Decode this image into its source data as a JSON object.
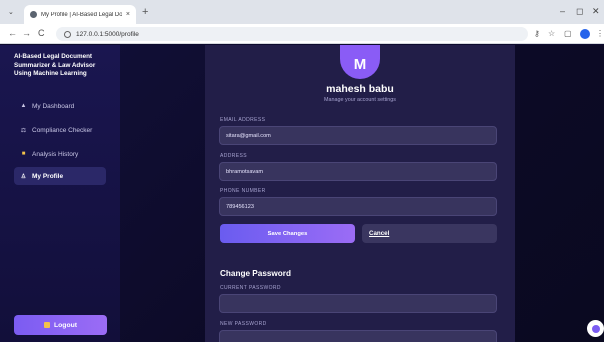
{
  "browser": {
    "tab_title": "My Profile | AI-Based Legal Docum",
    "tab_close": "×",
    "tab_menu": "⌄",
    "new_tab": "+",
    "url": "127.0.0.1:5000/profile",
    "window_controls": {
      "minimize": "–",
      "maximize": "◻",
      "close": "✕"
    },
    "nav": {
      "back": "←",
      "forward": "→",
      "reload": "C"
    },
    "tools": {
      "password": "⚷",
      "star": "☆",
      "extensions": "▢",
      "menu": "⋮"
    }
  },
  "sidebar": {
    "brand": "AI-Based Legal Document Summarizer & Law Advisor Using Machine Learning",
    "items": [
      {
        "label": "My Dashboard",
        "icon": "home-icon",
        "glyph": "▲"
      },
      {
        "label": "Compliance Checker",
        "icon": "scales-icon",
        "glyph": "⚖"
      },
      {
        "label": "Analysis History",
        "icon": "folder-icon",
        "glyph": "■"
      },
      {
        "label": "My Profile",
        "icon": "user-icon",
        "glyph": "♙"
      }
    ],
    "logout_label": "Logout"
  },
  "profile": {
    "avatar_letter": "M",
    "name": "mahesh babu",
    "subtitle": "Manage your account settings",
    "email_label": "EMAIL ADDRESS",
    "email_value": "sitara@gmail.com",
    "address_label": "ADDRESS",
    "address_value": "bhramotsavam",
    "phone_label": "PHONE NUMBER",
    "phone_value": "789456123",
    "save_label": "Save Changes",
    "cancel_label": "Cancel"
  },
  "password": {
    "title": "Change Password",
    "current_label": "CURRENT PASSWORD",
    "current_value": "",
    "new_label": "NEW PASSWORD",
    "new_value": ""
  },
  "colors": {
    "accent": "#8a5cf6",
    "background": "#0d0b2e",
    "panel": "#221e48"
  }
}
